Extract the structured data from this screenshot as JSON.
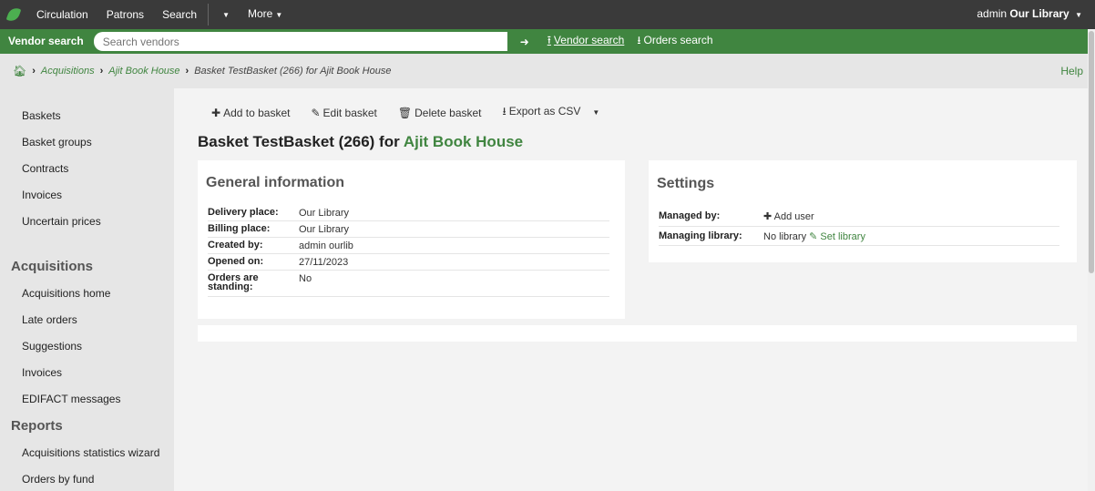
{
  "topbar": {
    "nav": [
      "Circulation",
      "Patrons",
      "Search"
    ],
    "more": "More",
    "user": "admin",
    "library": "Our Library"
  },
  "searchbar": {
    "label": "Vendor search",
    "placeholder": "Search vendors",
    "tabs": [
      "Vendor search",
      "Orders search"
    ]
  },
  "breadcrumb": {
    "items": [
      "Acquisitions",
      "Ajit Book House"
    ],
    "current": "Basket TestBasket (266) for Ajit Book House",
    "help": "Help"
  },
  "sidebar": {
    "group1": [
      "Baskets",
      "Basket groups",
      "Contracts",
      "Invoices",
      "Uncertain prices"
    ],
    "heading_acq": "Acquisitions",
    "group2": [
      "Acquisitions home",
      "Late orders",
      "Suggestions",
      "Invoices",
      "EDIFACT messages"
    ],
    "heading_reports": "Reports",
    "group3": [
      "Acquisitions statistics wizard",
      "Orders by fund"
    ]
  },
  "toolbar": {
    "add": "Add to basket",
    "edit": "Edit basket",
    "delete": "Delete basket",
    "export": "Export as CSV"
  },
  "title": {
    "prefix": "Basket TestBasket (266) for ",
    "vendor": "Ajit Book House"
  },
  "general": {
    "heading": "General information",
    "rows": [
      {
        "k": "Delivery place:",
        "v": "Our Library"
      },
      {
        "k": "Billing place:",
        "v": "Our Library"
      },
      {
        "k": "Created by:",
        "v": "admin ourlib"
      },
      {
        "k": "Opened on:",
        "v": "27/11/2023"
      },
      {
        "k": "Orders are standing:",
        "v": "No"
      }
    ]
  },
  "settings": {
    "heading": "Settings",
    "managed_by_label": "Managed by:",
    "add_user": "Add user",
    "managing_library_label": "Managing library:",
    "managing_library_value": "No library",
    "set_library": "Set library"
  },
  "colors": {
    "accent": "#408540",
    "topbar": "#3a3a3a"
  }
}
